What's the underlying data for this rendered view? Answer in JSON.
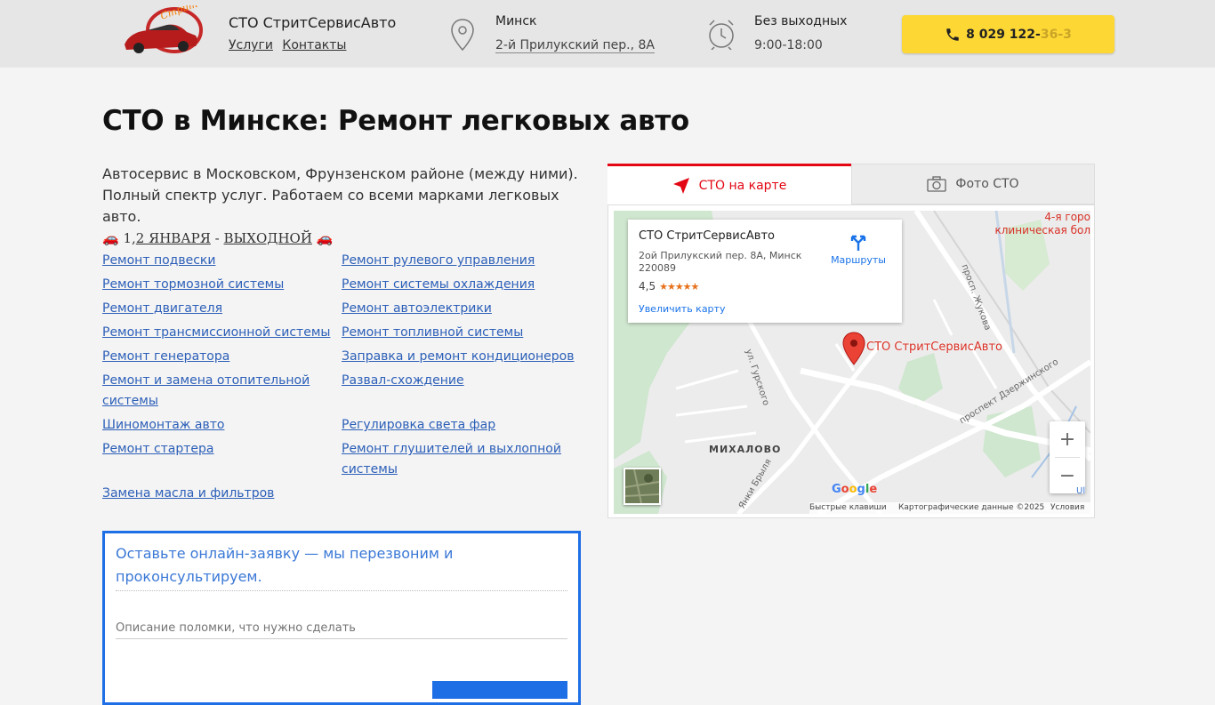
{
  "header": {
    "brand_name": "СТО СтритСервисАвто",
    "nav": [
      {
        "label": "Услуги"
      },
      {
        "label": "Контакты"
      }
    ],
    "city": "Минск",
    "address": "2-й Прилукский пер., 8А",
    "days": "Без выходных",
    "hours": "9:00-18:00",
    "phone_main": "8 029 122-",
    "phone_faded": "36-3"
  },
  "page": {
    "title": "СТО в Минске: Ремонт легковых авто",
    "intro_line1": "Автосервис в Московском, Фрунзенском районе (между ними).",
    "intro_line2": "Полный спектр услуг. Работаем со всеми марками легковых авто.",
    "holiday_emoji": "🚗",
    "holiday_prefix": "1,",
    "holiday_date": "2 ЯНВАРЯ",
    "holiday_dash": " - ",
    "holiday_word": "ВЫХОДНОЙ"
  },
  "services": [
    {
      "label": "Ремонт подвески"
    },
    {
      "label": "Ремонт рулевого управления"
    },
    {
      "label": "Ремонт тормозной системы"
    },
    {
      "label": "Ремонт системы охлаждения"
    },
    {
      "label": "Ремонт двигателя"
    },
    {
      "label": "Ремонт автоэлектрики"
    },
    {
      "label": "Ремонт трансмиссионной системы"
    },
    {
      "label": "Ремонт топливной системы"
    },
    {
      "label": "Ремонт генератора"
    },
    {
      "label": "Заправка и ремонт кондиционеров"
    },
    {
      "label": "Ремонт и замена отопительной системы"
    },
    {
      "label": "Развал-схождение"
    },
    {
      "label": "Шиномонтаж авто"
    },
    {
      "label": "Регулировка света фар"
    },
    {
      "label": "Ремонт стартера"
    },
    {
      "label": "Ремонт глушителей и выхлопной системы"
    },
    {
      "label": "Замена масла и фильтров"
    }
  ],
  "form": {
    "title": "Оставьте онлайн-заявку — мы перезвоним и проконсультируем.",
    "placeholder": "Описание поломки, что нужно сделать"
  },
  "tabs": [
    {
      "label": "СТО на карте",
      "icon": "navigation-arrow-icon"
    },
    {
      "label": "Фото СТО",
      "icon": "camera-icon"
    }
  ],
  "map": {
    "card_name": "СТО СтритСервисАвто",
    "card_address": "2ой Прилукский пер. 8А, Минск 220089",
    "rating": "4,5",
    "stars": "★★★★★",
    "routes_label": "Маршруты",
    "zoom_link": "Увеличить карту",
    "marker_label": "СТО СтритСервисАвто",
    "hospital_label": "4-я горо клиническая бол",
    "district": "МИХАЛОВО",
    "street_zhukova": "просп. Жукова",
    "street_gurskogo": "ул. Гурского",
    "street_dzerzhinskogo": "проспект Дзержинского",
    "street_brylya": "Янки Брыля",
    "zoom_in": "+",
    "zoom_out": "−",
    "google": [
      "G",
      "o",
      "o",
      "g",
      "l",
      "e"
    ],
    "footer_shortcuts": "Быстрые клавиши",
    "footer_data": "Картографические данные ©2025",
    "footer_terms": "Условия",
    "edge_label": "Ul"
  },
  "colors": {
    "accent_red": "#e30613",
    "phone_yellow": "#fdd835",
    "form_blue": "#1e6ee6",
    "link_blue": "#2c5fb8"
  }
}
